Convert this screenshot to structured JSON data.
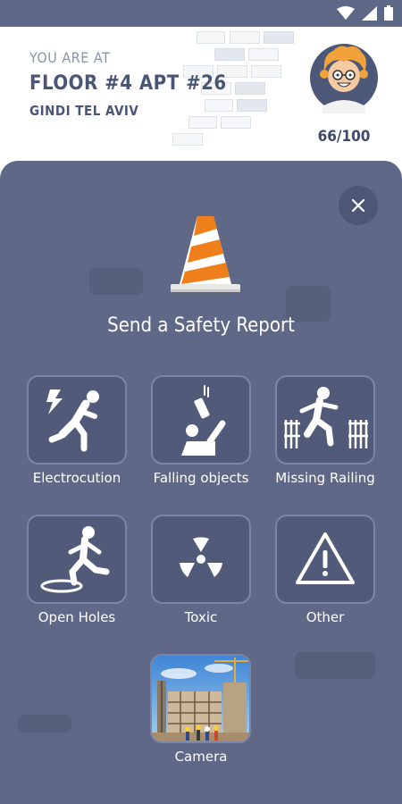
{
  "header": {
    "location_label": "YOU ARE AT",
    "apartment": "FLOOR #4 APT #26",
    "site": "GINDI TEL AVIV",
    "score": "66/100"
  },
  "modal": {
    "title": "Send a Safety Report",
    "categories": [
      {
        "label": "Electrocution",
        "icon": "electrocution-icon"
      },
      {
        "label": "Falling objects",
        "icon": "falling-objects-icon"
      },
      {
        "label": "Missing Railing",
        "icon": "missing-railing-icon"
      },
      {
        "label": "Open Holes",
        "icon": "open-hole-icon"
      },
      {
        "label": "Toxic",
        "icon": "radiation-icon"
      },
      {
        "label": "Other",
        "icon": "warning-icon"
      }
    ],
    "camera_label": "Camera"
  },
  "colors": {
    "status_bar": "#5d6887",
    "sheet": "#5f6987",
    "tile": "#515b79",
    "tile_border": "#7b86a4",
    "cone_orange": "#ef7f1a",
    "header_text": "#4a5677"
  }
}
